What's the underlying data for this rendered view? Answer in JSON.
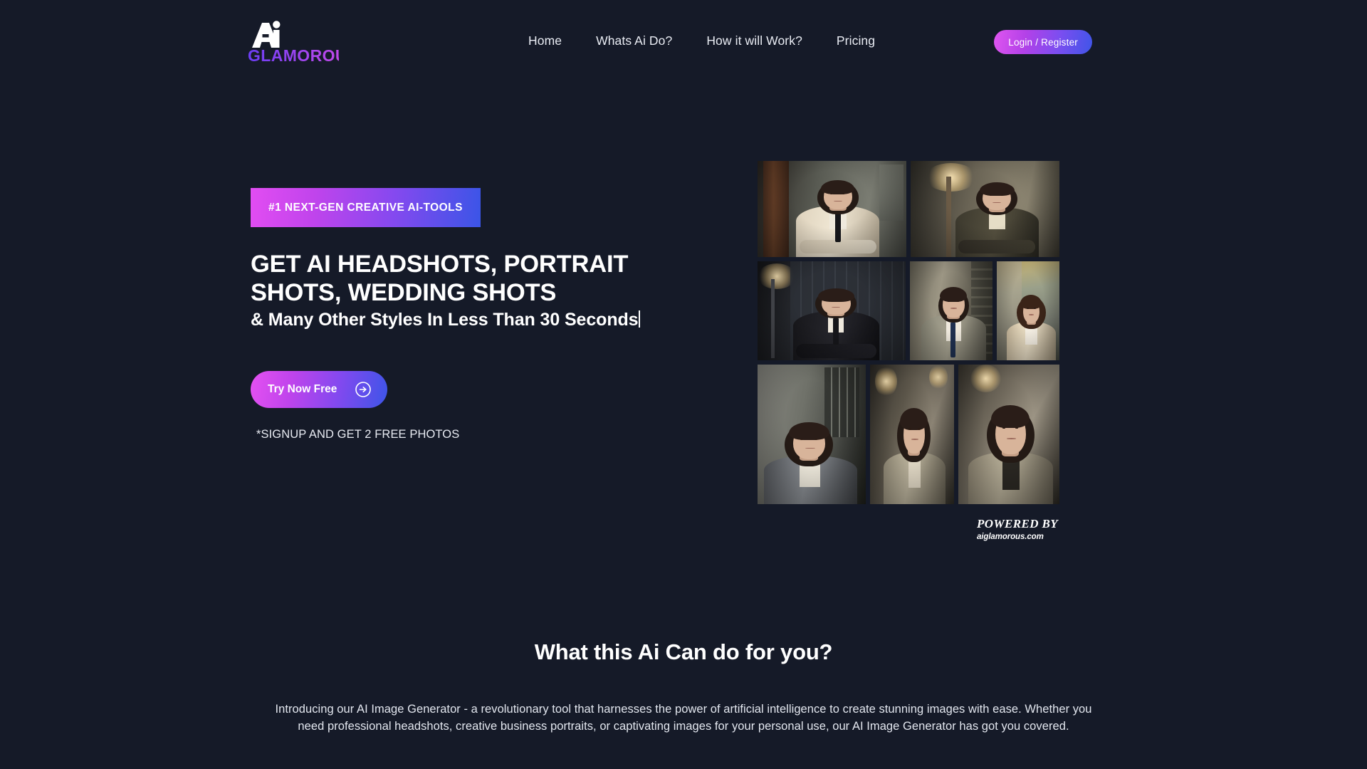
{
  "brand": {
    "logo_mark": "ai-monogram-icon",
    "logo_wordmark": "GLAMOROUS",
    "gradient_start": "#7b3ff2",
    "gradient_end": "#c04ae8"
  },
  "header": {
    "nav": [
      {
        "label": "Home"
      },
      {
        "label": "Whats Ai Do?"
      },
      {
        "label": "How it will Work?"
      },
      {
        "label": "Pricing"
      }
    ],
    "login_label": "Login / Register"
  },
  "hero": {
    "badge": "#1 NEXT-GEN CREATIVE AI-TOOLS",
    "headline": "GET AI HEADSHOTS, PORTRAIT SHOTS, WEDDING SHOTS",
    "subheadline": "& Many Other Styles In Less Than 30 Seconds",
    "cta_label": "Try Now Free",
    "cta_icon": "arrow-right-circle-icon",
    "signup_note": "*SIGNUP AND GET 2 FREE PHOTOS"
  },
  "collage": {
    "powered_by_label": "POWERED BY",
    "powered_by_site": "aiglamorous.com",
    "tiles": [
      {
        "alt": "woman in cream suit with black tie, arms crossed"
      },
      {
        "alt": "woman in dark suit beside floor lamp, arms crossed"
      },
      {
        "alt": "woman in black suit and tie in studio, arms crossed"
      },
      {
        "alt": "woman in grey blazer with navy tie indoors"
      },
      {
        "alt": "woman in beige coat outdoors with autumn trees"
      },
      {
        "alt": "woman in grey blazer by window"
      },
      {
        "alt": "woman in taupe blazer under pendant light"
      },
      {
        "alt": "woman in taupe blazer in sunlit corridor"
      }
    ]
  },
  "about": {
    "title": "What this Ai Can do for you?",
    "body": "Introducing our AI Image Generator - a revolutionary tool that harnesses the power of artificial intelligence to create stunning images with ease. Whether you need professional headshots, creative business portraits, or captivating images for your personal use, our AI Image Generator has got you covered."
  },
  "theme": {
    "background": "#151a28",
    "text_primary": "#ffffff",
    "accent_pink": "#e24df2",
    "accent_blue": "#3b55e7"
  }
}
